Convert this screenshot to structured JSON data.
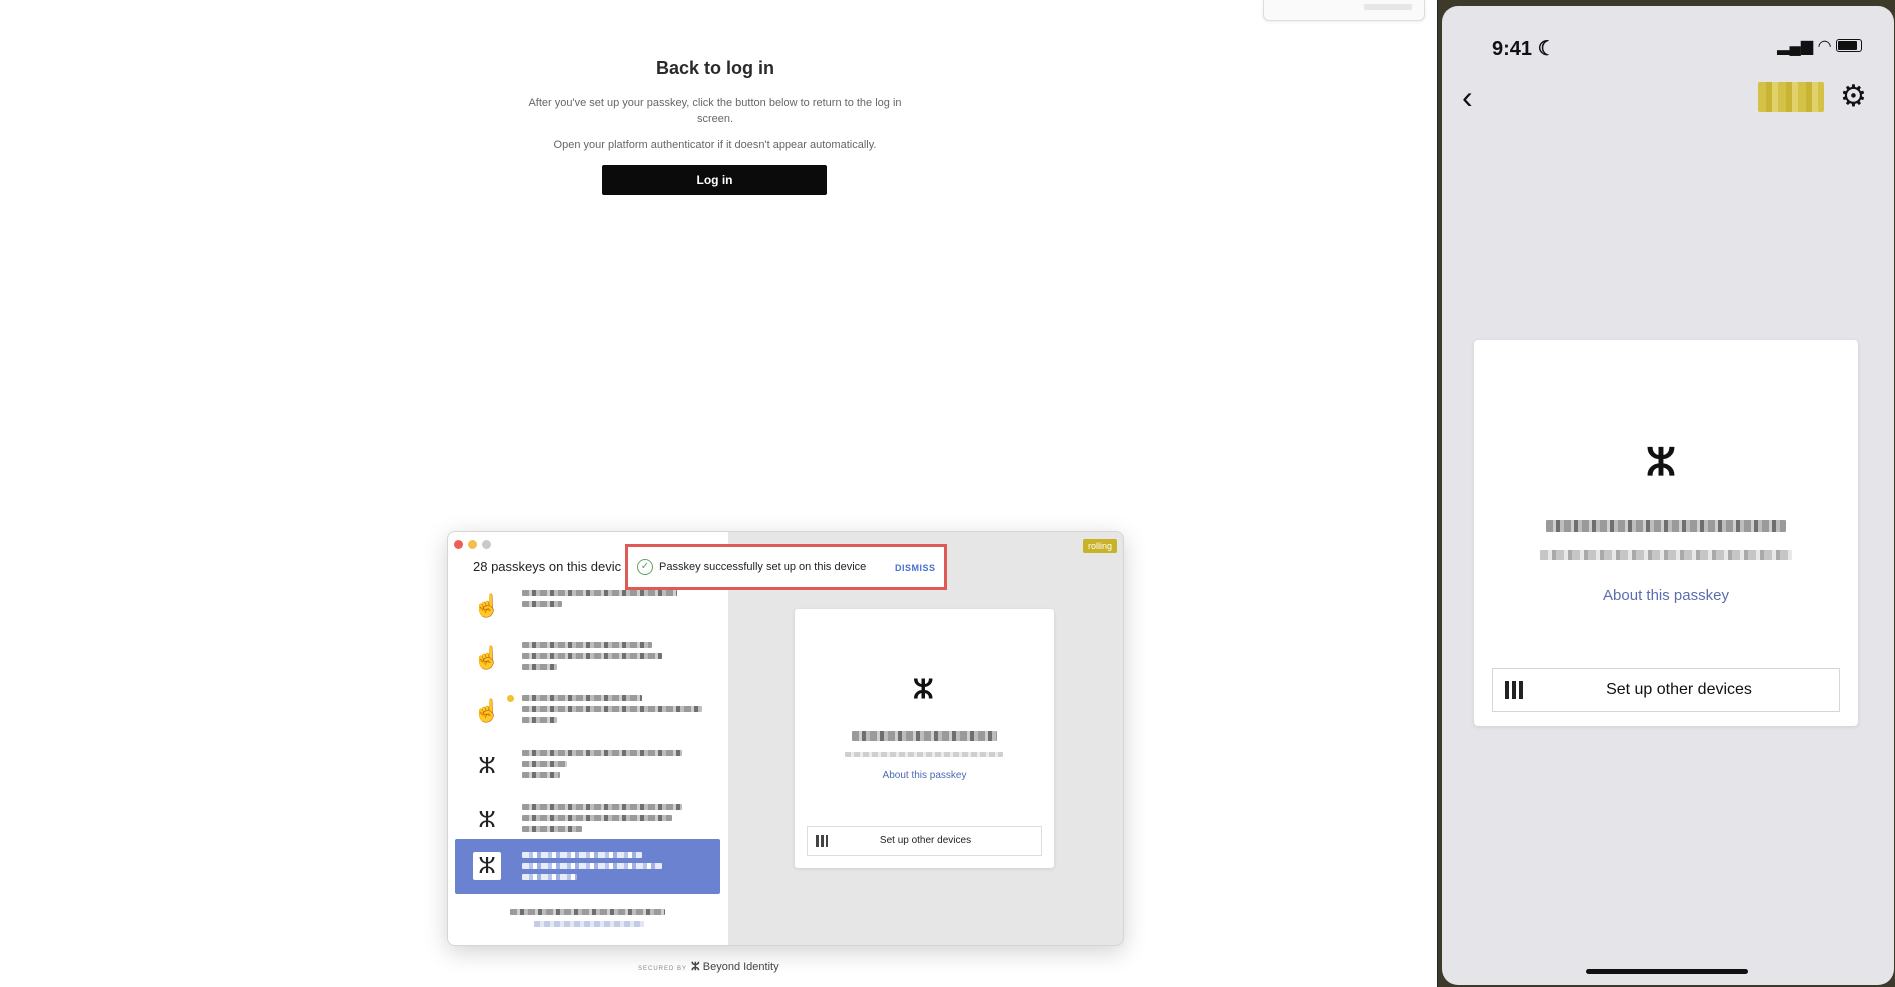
{
  "page": {
    "title": "Back to log in",
    "description": "After you've set up your passkey, click the button below to return to the log in screen.",
    "hint": "Open your platform authenticator if it doesn't appear automatically.",
    "login_button": "Log in"
  },
  "desktop_app": {
    "passkey_count_label": "28 passkeys on this devic",
    "rolling_badge": "rolling",
    "toast": {
      "message": "Passkey successfully set up on this device",
      "dismiss": "DISMISS"
    },
    "card": {
      "about_link": "About this passkey",
      "setup_button": "Set up other devices"
    }
  },
  "footer": {
    "secured_by": "SECURED BY",
    "brand": "Beyond Identity"
  },
  "phone": {
    "time": "9:41",
    "about_link": "About this passkey",
    "setup_button": "Set up other devices"
  },
  "colors": {
    "accent_blue": "#6a82d0",
    "toast_border": "#de5a55",
    "rolling_badge": "#c8b227"
  }
}
